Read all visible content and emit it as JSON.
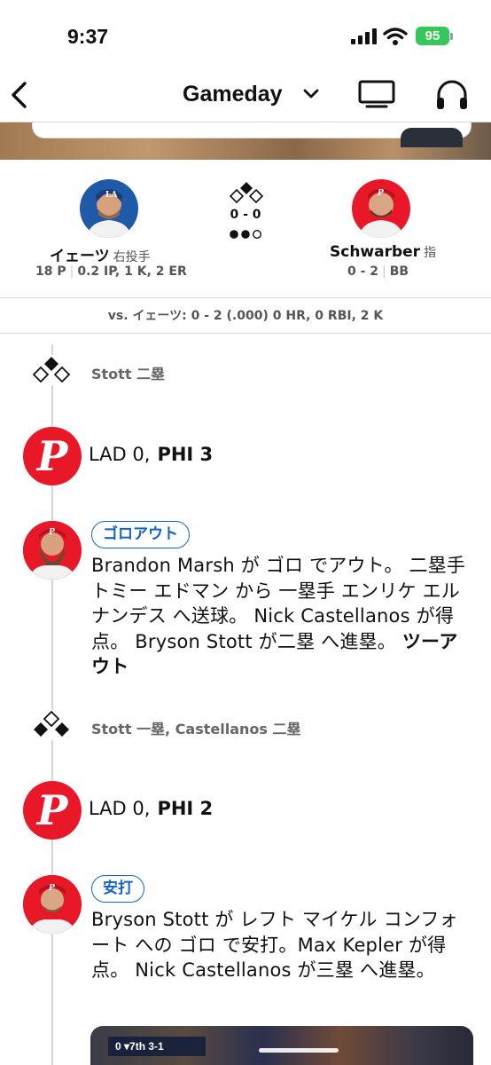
{
  "status_bar": {
    "time": "9:37",
    "battery": "95"
  },
  "nav": {
    "title": "Gameday"
  },
  "matchup": {
    "pitcher": {
      "name": "イェーツ",
      "role": "右投手",
      "pitches": "18 P",
      "line": "0.2 IP, 1 K, 2 ER"
    },
    "batter": {
      "name": "Schwarber",
      "role": "指",
      "ab": "0 - 2",
      "result": "BB"
    },
    "count": "0 - 0",
    "vs_line": "vs. イェーツ: 0 - 2 (.000) 0 HR, 0 RBI, 2 K"
  },
  "feed": {
    "runners_1": "Stott 二塁",
    "score_1": {
      "away": "LAD 0,",
      "home": "PHI 3"
    },
    "play_1": {
      "badge": "ゴロアウト",
      "desc": "Brandon Marsh が ゴロ でアウト。 二塁手 トミー エドマン から 一塁手 エンリケ エルナンデス へ送球。 Nick Castellanos が得点。 Bryson Stott が二塁 へ進塁。 ",
      "outs": "ツーアウト"
    },
    "runners_2": "Stott 一塁, Castellanos 二塁",
    "score_2": {
      "away": "LAD 0,",
      "home": "PHI 2"
    },
    "play_2": {
      "badge": "安打",
      "desc": "Bryson Stott が レフト マイケル コンフォート への ゴロ で安打。Max Kepler が得点。 Nick Castellanos が三塁 へ進塁。"
    },
    "video": {
      "score_bug": "0  ▾7th   3-1"
    }
  },
  "colors": {
    "phillies_red": "#e81828",
    "dodgers_blue": "#1e5aa8",
    "badge_blue": "#1565c0",
    "battery_green": "#34c759"
  }
}
